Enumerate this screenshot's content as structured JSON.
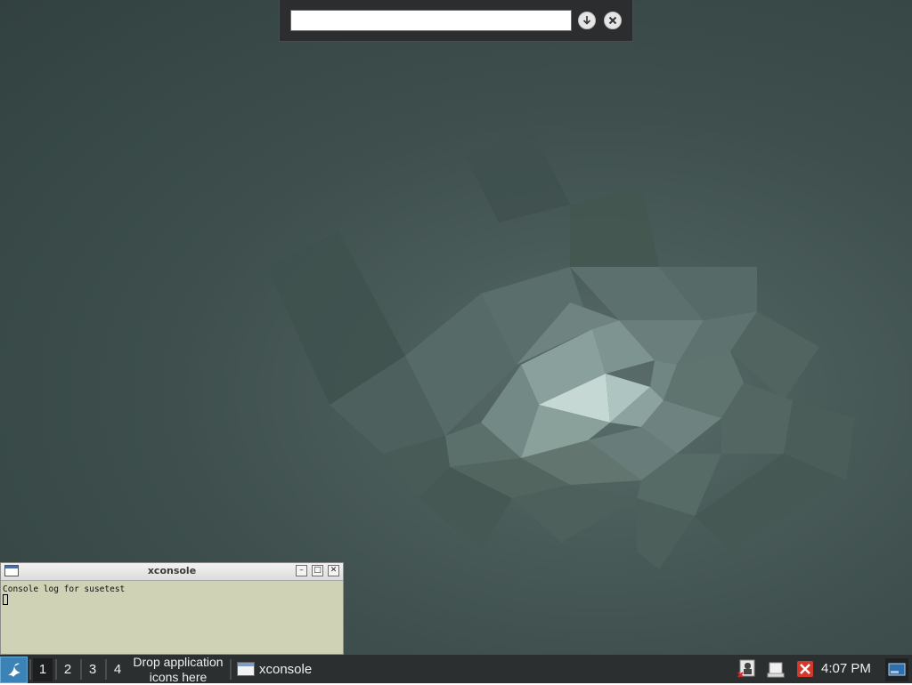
{
  "runbar": {
    "input_value": "",
    "run_icon": "download-circle-icon",
    "close_icon": "close-circle-icon"
  },
  "xconsole": {
    "title": "xconsole",
    "app_icon": "window-icon",
    "minimize_icon": "minimize-icon",
    "maximize_icon": "maximize-icon",
    "close_icon": "close-icon",
    "log_lines": [
      "Console log for susetest"
    ]
  },
  "taskbar": {
    "start_icon": "menu-start-icon",
    "workspaces": [
      "1",
      "2",
      "3",
      "4"
    ],
    "active_workspace": "1",
    "launcher_placeholder": "Drop application icons here",
    "tasks": [
      {
        "label": "xconsole",
        "icon": "window-icon"
      }
    ],
    "tray": [
      "network-disconnected-icon",
      "removable-drive-icon",
      "error-x-icon"
    ],
    "clock": "4:07 PM",
    "show_desktop_icon": "show-desktop-icon"
  },
  "colors": {
    "desktop_bg": "#3e4f4d",
    "taskbar_bg": "#2c2f30",
    "console_bg": "#cfd2b4",
    "start_accent": "#3b82b7"
  }
}
